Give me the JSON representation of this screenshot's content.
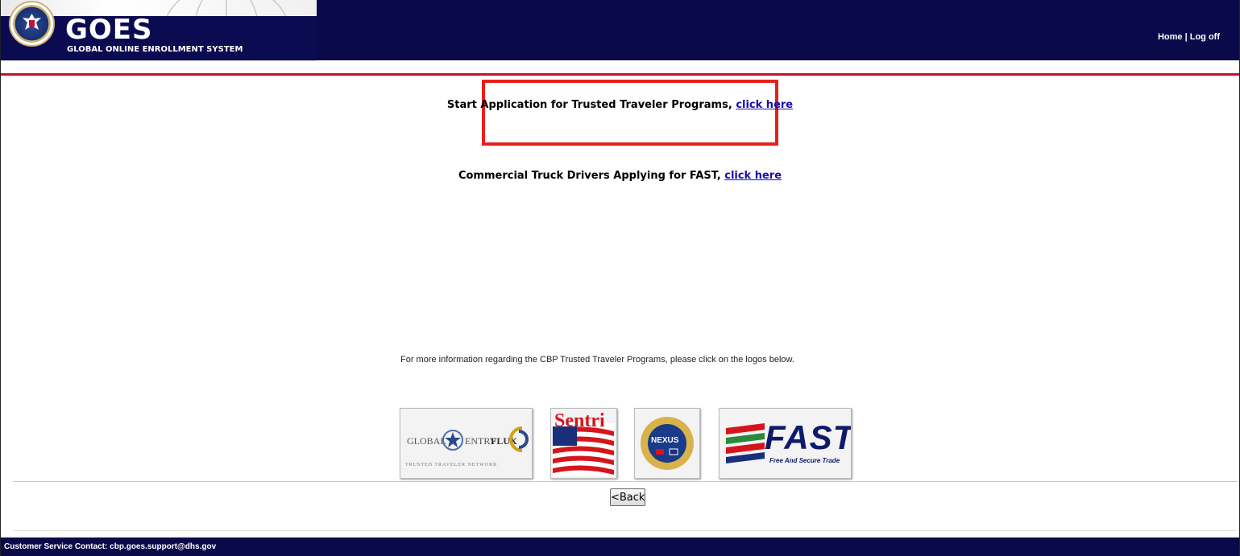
{
  "header": {
    "app_name": "GOES",
    "subtitle": "GLOBAL ONLINE ENROLLMENT SYSTEM",
    "nav_home": "Home",
    "nav_separator": "|",
    "nav_logoff": "Log off"
  },
  "main": {
    "start_application_text": "Start Application for Trusted Traveler Programs,",
    "start_application_link": "click here",
    "fast_text": "Commercial Truck Drivers Applying for FAST,",
    "fast_link": "click here",
    "more_info_text": "For more information regarding the CBP Trusted Traveler Programs, please click on the logos below.",
    "logos": {
      "global_entry": {
        "text_global": "GLOBAL",
        "text_entry": "ENTRY",
        "text_flux": "FLUX",
        "tagline": "TRUSTED TRAVELER NETWORK"
      },
      "sentri": {
        "text": "Sentri"
      },
      "nexus": {
        "text": "NEXUS"
      },
      "fast": {
        "text": "FAST",
        "tagline": "Free And Secure Trade"
      }
    },
    "back_button": "<Back"
  },
  "footer": {
    "contact_text": "Customer Service Contact: cbp.goes.support@dhs.gov"
  },
  "colors": {
    "header_navy": "#0a0a4a",
    "accent_red": "#c8102e",
    "highlight_red": "#e8201a",
    "link_blue": "#1a0dab"
  }
}
